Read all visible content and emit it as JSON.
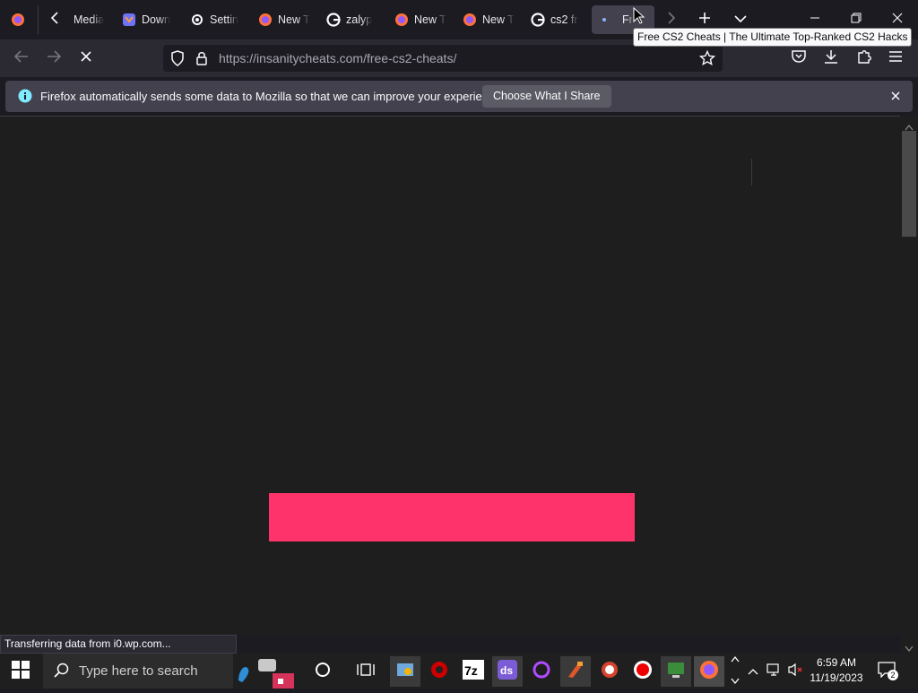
{
  "tabs": [
    {
      "label": "",
      "icon": "firefox-icon"
    },
    {
      "label": "Media",
      "icon": ""
    },
    {
      "label": "Down",
      "icon": "download-shield-icon"
    },
    {
      "label": "Settin",
      "icon": "gear-icon"
    },
    {
      "label": "New T",
      "icon": "firefox-icon"
    },
    {
      "label": "zalyp",
      "icon": "google-icon"
    },
    {
      "label": "New T",
      "icon": "firefox-icon"
    },
    {
      "label": "New T",
      "icon": "firefox-icon"
    },
    {
      "label": "cs2 fr",
      "icon": "google-icon"
    },
    {
      "label": "Fr",
      "icon": "loading-dot-icon"
    }
  ],
  "tooltip": "Free CS2 Cheats | The Ultimate Top-Ranked CS2 Hacks",
  "url": "https://insanitycheats.com/free-cs2-cheats/",
  "infobar": {
    "message": "Firefox automatically sends some data to Mozilla so that we can improve your experience.",
    "button": "Choose What I Share"
  },
  "status": "Transferring data from i0.wp.com...",
  "taskbar": {
    "search_placeholder": "Type here to search",
    "time": "6:59 AM",
    "date": "11/19/2023",
    "notification_count": "2"
  },
  "colors": {
    "accent_pink": "#ff336b",
    "bg": "#1c1b22"
  }
}
